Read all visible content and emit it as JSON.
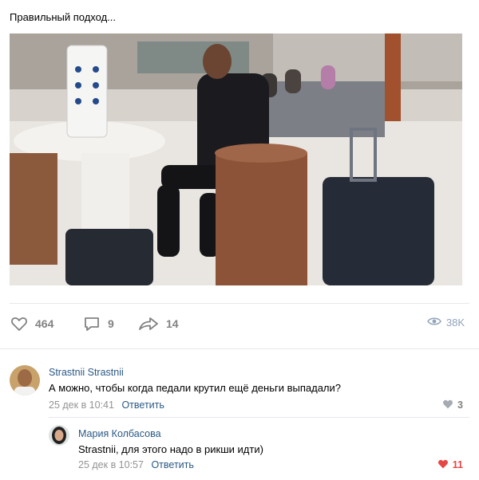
{
  "post": {
    "text": "Правильный подход..."
  },
  "actions": {
    "likes": "464",
    "comments": "9",
    "shares": "14",
    "views": "38K"
  },
  "comments": [
    {
      "author": "Strastnii Strastnii",
      "text": "А можно, чтобы когда педали крутил ещё деньги выпадали?",
      "date": "25 дек в 10:41",
      "reply_label": "Ответить",
      "likes": "3"
    },
    {
      "author": "Мария Колбасова",
      "text": "Strastnii, для этого надо в рикши идти)",
      "date": "25 дек в 10:57",
      "reply_label": "Ответить",
      "likes": "11"
    }
  ],
  "colors": {
    "link": "#2a5885",
    "muted": "#828282",
    "liked_red": "#e64646"
  }
}
